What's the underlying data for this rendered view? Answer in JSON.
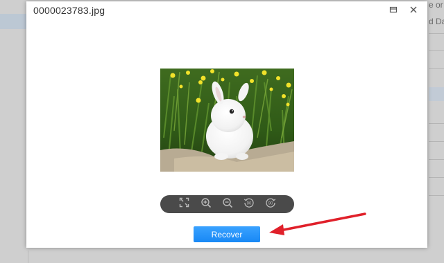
{
  "background_app": {
    "right_text_line1": "e or",
    "right_text_line2": "d Da"
  },
  "modal": {
    "title": "0000023783.jpg",
    "restore_icon": "window-restore-icon",
    "close_icon": "close-icon"
  },
  "image": {
    "subject": "white bunny rabbit sitting on a stone in green grass with yellow flowers"
  },
  "toolbar": {
    "tools": [
      {
        "icon": "fit-to-window-icon"
      },
      {
        "icon": "zoom-in-icon"
      },
      {
        "icon": "zoom-out-icon"
      },
      {
        "icon": "rotate-left-icon",
        "text": "90"
      },
      {
        "icon": "rotate-right-icon",
        "text": "90"
      }
    ]
  },
  "actions": {
    "recover_label": "Recover"
  },
  "annotation": {
    "arrow_color": "#e0202a"
  },
  "colors": {
    "accent": "#1e8cf7",
    "toolbar_bg": "#4a4a4a",
    "arrow": "#e0202a"
  }
}
